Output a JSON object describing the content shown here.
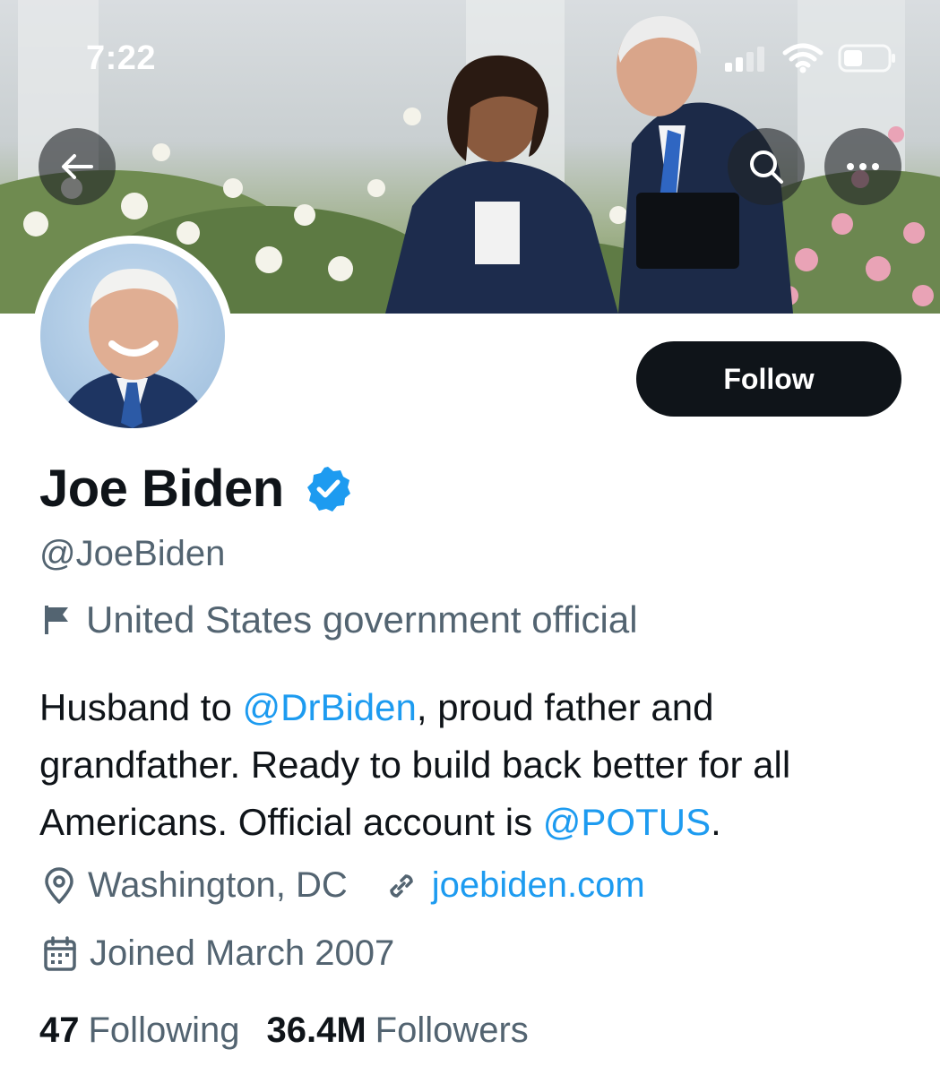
{
  "status_bar": {
    "time": "7:22"
  },
  "icons": {
    "back": "arrow-left-icon",
    "search": "search-icon",
    "more": "more-dots-icon",
    "verified": "verified-badge-icon",
    "label": "flag-icon",
    "location": "location-pin-icon",
    "link": "link-icon",
    "joined": "calendar-icon"
  },
  "profile": {
    "follow_label": "Follow",
    "display_name": "Joe Biden",
    "handle": "@JoeBiden",
    "label": "United States government official",
    "bio": {
      "part1": "Husband to ",
      "mention1": "@DrBiden",
      "part2": ", proud father and grandfather. Ready to build back better for all Americans. Official account is ",
      "mention2": "@POTUS",
      "part3": "."
    },
    "location": "Washington, DC",
    "website": "joebiden.com",
    "joined": "Joined March 2007",
    "following_count": "47",
    "following_label": "Following",
    "followers_count": "36.4M",
    "followers_label": "Followers"
  },
  "colors": {
    "accent": "#1d9bf0",
    "text_primary": "#0f1419",
    "text_secondary": "#536471"
  }
}
